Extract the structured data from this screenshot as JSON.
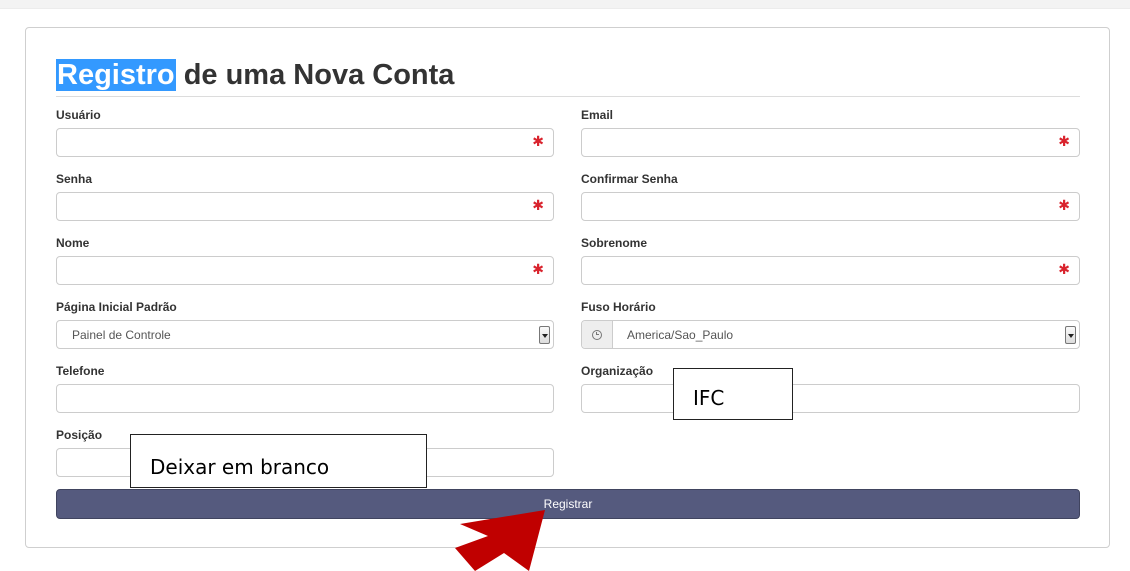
{
  "title": {
    "highlighted": "Registro",
    "rest": " de uma Nova Conta"
  },
  "fields": {
    "usuario": {
      "label": "Usuário",
      "required_mark": "✱"
    },
    "email": {
      "label": "Email",
      "required_mark": "✱"
    },
    "senha": {
      "label": "Senha",
      "required_mark": "✱"
    },
    "confirmar_senha": {
      "label": "Confirmar Senha",
      "required_mark": "✱"
    },
    "nome": {
      "label": "Nome",
      "required_mark": "✱"
    },
    "sobrenome": {
      "label": "Sobrenome",
      "required_mark": "✱"
    },
    "pagina_inicial": {
      "label": "Página Inicial Padrão",
      "value": "Painel de Controle"
    },
    "fuso_horario": {
      "label": "Fuso Horário",
      "value": "America/Sao_Paulo",
      "icon": "clock-icon"
    },
    "telefone": {
      "label": "Telefone"
    },
    "organizacao": {
      "label": "Organização"
    },
    "posicao": {
      "label": "Posição"
    }
  },
  "submit": {
    "label": "Registrar"
  },
  "annotations": {
    "organizacao_note": "IFC",
    "posicao_note": "Deixar em branco",
    "arrow_color": "#c00000"
  },
  "colors": {
    "title_highlight": "#3399ff",
    "button_bg": "#555a7e",
    "required": "#d9232d"
  }
}
